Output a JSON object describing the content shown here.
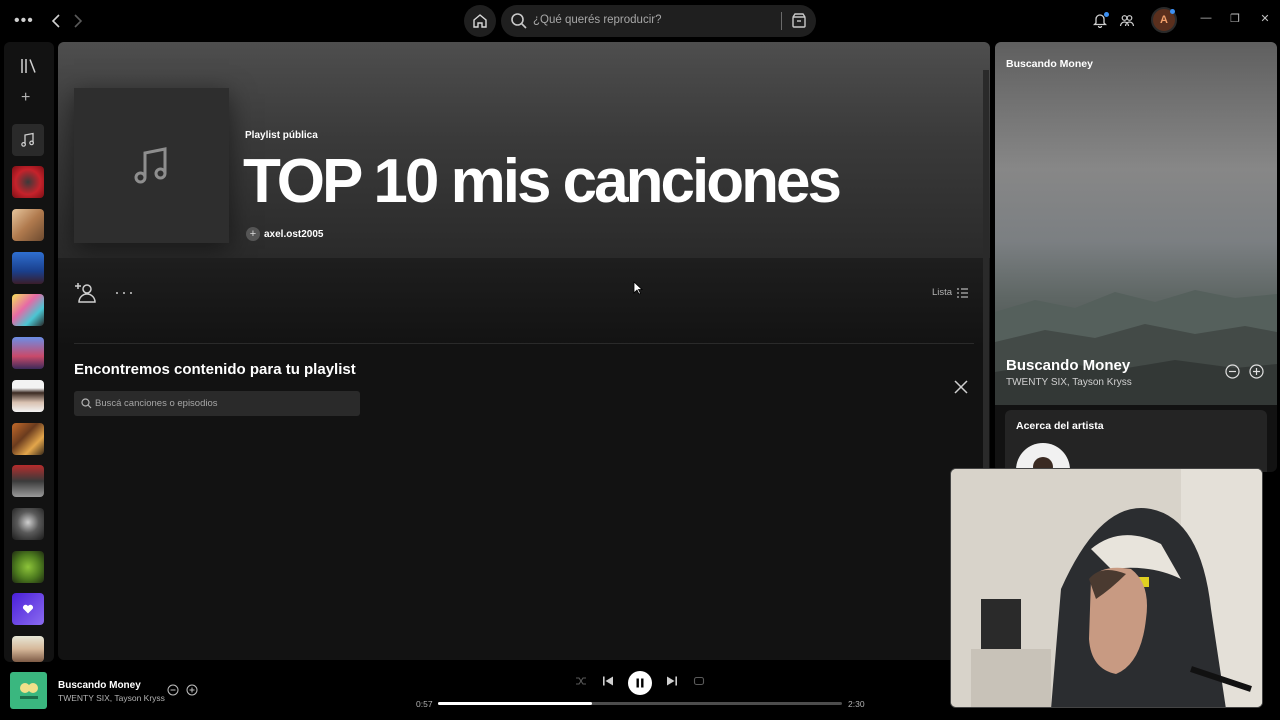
{
  "topbar": {
    "search_placeholder": "¿Qué querés reproducir?",
    "avatar_letter": "A",
    "window_min": "—",
    "window_max": "❐",
    "window_close": "✕"
  },
  "playlist": {
    "type_label": "Playlist pública",
    "title": "TOP 10 mis canciones",
    "owner": "axel.ost2005",
    "view_mode": "Lista"
  },
  "find": {
    "title": "Encontremos contenido para tu playlist",
    "search_placeholder": "Buscá canciones o episodios"
  },
  "right_panel": {
    "header": "Buscando Money",
    "song_title": "Buscando Money",
    "artists": "TWENTY SIX, Tayson Kryss",
    "about_title": "Acerca del artista"
  },
  "player": {
    "title": "Buscando Money",
    "artists": "TWENTY SIX, Tayson Kryss",
    "current_time": "0:57",
    "total_time": "2:30",
    "progress_fraction": 0.38
  },
  "colors": {
    "accent_green": "#1db954",
    "background": "#121212",
    "notification_dot": "#3d91f4"
  }
}
